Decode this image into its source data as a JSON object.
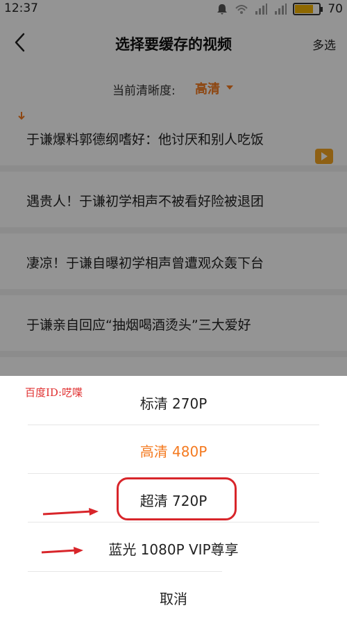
{
  "status_bar": {
    "time": "12:37",
    "battery": "70",
    "icons": [
      "bell-icon",
      "wifi-icon",
      "signal-icon",
      "signal-icon",
      "battery-icon"
    ]
  },
  "header": {
    "title": "选择要缓存的视频",
    "multi_select": "多选"
  },
  "quality": {
    "label": "当前清晰度:",
    "value": "高清"
  },
  "videos": [
    {
      "title": "于谦爆料郭德纲嗜好：他讨厌和别人吃饭"
    },
    {
      "title": "遇贵人！于谦初学相声不被看好险被退团"
    },
    {
      "title": "凄凉！于谦自曝初学相声曾遭观众轰下台"
    },
    {
      "title": "于谦亲自回应“抽烟喝酒烫头”三大爱好"
    }
  ],
  "sheet": {
    "watermark": "百度ID:呓喋",
    "options": [
      {
        "label": "标清 270P"
      },
      {
        "label": "高清 480P",
        "selected": true
      },
      {
        "label": "超清 720P",
        "highlighted": true
      },
      {
        "label": "蓝光 1080P  VIP尊享"
      }
    ],
    "cancel": "取消"
  },
  "colors": {
    "accent": "#f47a20",
    "annotation_red": "#d8252a",
    "overlay": "rgba(0,0,0,0.42)"
  }
}
